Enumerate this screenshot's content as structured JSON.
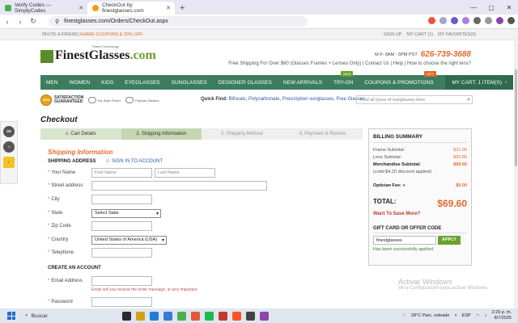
{
  "browser": {
    "tabs": [
      {
        "title": "Verify Codes — SimplyCodes",
        "active": false
      },
      {
        "title": "CheckOut by finestglasses.com",
        "active": true
      }
    ],
    "url": "finestglasses.com/Orders/CheckOut.aspx",
    "new_tab": "+"
  },
  "topbar": {
    "invite_prefix": "INVITE A FRIEND,",
    "invite_offer": "SHARE COUPONS & 20% OFF.",
    "links": [
      "SIGN UP",
      "MY CART (1)",
      "MY FAVORITES(0)"
    ]
  },
  "header": {
    "brand_a": "Finest",
    "brand_b": "Glasses",
    "brand_c": ".com",
    "patent": "Patent Technology",
    "hours": "M-F: 8AM - 5PM PST",
    "phone": "626-739-3688",
    "shipping": "Free Shipping For Over $60 (Glasses Frames + Lenses Only)",
    "contact": "Contact Us",
    "help": "Help",
    "choose": "How to choose the right lens?"
  },
  "nav": {
    "items": [
      "MEN",
      "WOMEN",
      "KIDS",
      "EYEGLASSES",
      "SUNGLASSES",
      "DESIGNER GLASSES",
      "NEW ARRIVALS",
      "TRY-ON",
      "COUPONS & PROMOTIONS"
    ],
    "badge_new": "NEW",
    "badge_hot": "HOT",
    "cart": "MY CART: 1 ITEM(S)"
  },
  "trust": {
    "satisfaction": "SATISFACTION",
    "guaranteed": "GUARANTEED",
    "seal": "100%",
    "style_finder": "My Style Finder",
    "popular": "Popular Glasses",
    "quick_label": "Quick Find:",
    "quick_links": [
      "Bifocals",
      "Polycarbonate",
      "Prescription sunglasses",
      "Free Glasses"
    ],
    "search_placeholder": "Find all types of eyeglasses here."
  },
  "checkout": {
    "title": "Checkout",
    "steps": [
      "√. Cart Details",
      "2. Shipping Information",
      "3. Shipping Method",
      "4. Payment & Review"
    ]
  },
  "form": {
    "section": "Shipping Information",
    "shipping_address": "SHIPPING ADDRESS",
    "sign_in": "SIGN IN TO ACCOUNT",
    "labels": {
      "name": "Your Name",
      "street": "Street address",
      "city": "City",
      "state": "State",
      "zip": "Zip Code",
      "country": "Country",
      "phone": "Telephone",
      "email": "Email Address",
      "password": "Password"
    },
    "first_name_placeholder": "First Name",
    "last_name_placeholder": "Last Name",
    "state_value": "Select State",
    "country_value": "United States of America (USA)",
    "create_account": "CREATE AN ACCOUNT",
    "email_hint": "Email will you receive the order message, is very important."
  },
  "billing": {
    "title": "BILLING SUMMARY",
    "frame_subtotal_label": "Frame Subtotal:",
    "frame_subtotal": "$21.90",
    "lens_subtotal_label": "Lens Subtotal:",
    "lens_subtotal": "$52.80",
    "merch_subtotal_label": "Merchandise Subtotal:",
    "merch_subtotal": "$69.60",
    "discount_note": "(code:$4.20 discount applied)",
    "optician_label": "Optician Fee:",
    "optician_fee": "$0.00",
    "total_label": "TOTAL:",
    "total": "$69.60",
    "want_save": "Want To Save More?",
    "gift_title": "GIFT CARD OR OFFER CODE",
    "gift_value": "finestglasses",
    "apply": "APPLY",
    "success": "Has been successfully applied."
  },
  "watermark": {
    "line1": "Activar Windows",
    "line2": "Ve a Configuración para activar Windows."
  },
  "taskbar": {
    "search": "Buscar",
    "weather": "28°C  Parc. soleado",
    "lang": "ESP",
    "time": "2:29 p. m.",
    "date": "8/7/2025"
  },
  "colors": {
    "accent": "#e36b2c",
    "nav_green": "#3c7d5e",
    "brand_green": "#6aa12d"
  }
}
